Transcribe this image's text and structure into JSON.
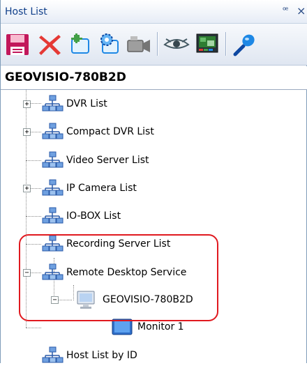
{
  "panel": {
    "title": "Host List",
    "pin_glyph": "ꟹ",
    "close_glyph": "×"
  },
  "toolbar": {
    "tools": [
      {
        "name": "save-icon",
        "color": "#d81b60"
      },
      {
        "name": "delete-icon",
        "color": "#e53935"
      },
      {
        "name": "add-host-icon",
        "color": "#2e7d32"
      },
      {
        "name": "settings-icon",
        "color": "#1976d2"
      },
      {
        "name": "camera-icon",
        "color": "#616161"
      },
      {
        "name": "view-eye-icon",
        "color": "#455a64"
      },
      {
        "name": "monitor-display-icon",
        "color": "#1b5e20"
      },
      {
        "name": "microphone-icon",
        "color": "#1565c0"
      }
    ]
  },
  "host": {
    "name": "GEOVISIO-780B2D"
  },
  "tree": {
    "items": [
      {
        "label": "DVR List",
        "expander": "+"
      },
      {
        "label": "Compact DVR List",
        "expander": "+"
      },
      {
        "label": "Video Server List",
        "expander": ""
      },
      {
        "label": "IP Camera List",
        "expander": "+"
      },
      {
        "label": "IO-BOX List",
        "expander": ""
      },
      {
        "label": "Recording Server List",
        "expander": ""
      },
      {
        "label": "Remote Desktop Service",
        "expander": "−"
      },
      {
        "label": "GEOVISIO-780B2D",
        "expander": "−"
      },
      {
        "label": "Monitor 1",
        "expander": ""
      },
      {
        "label": "Host List by ID",
        "expander": ""
      }
    ]
  },
  "colors": {
    "highlight": "#e0191f",
    "network_icon": "#3b6fbf",
    "title_text": "#103f8a"
  }
}
